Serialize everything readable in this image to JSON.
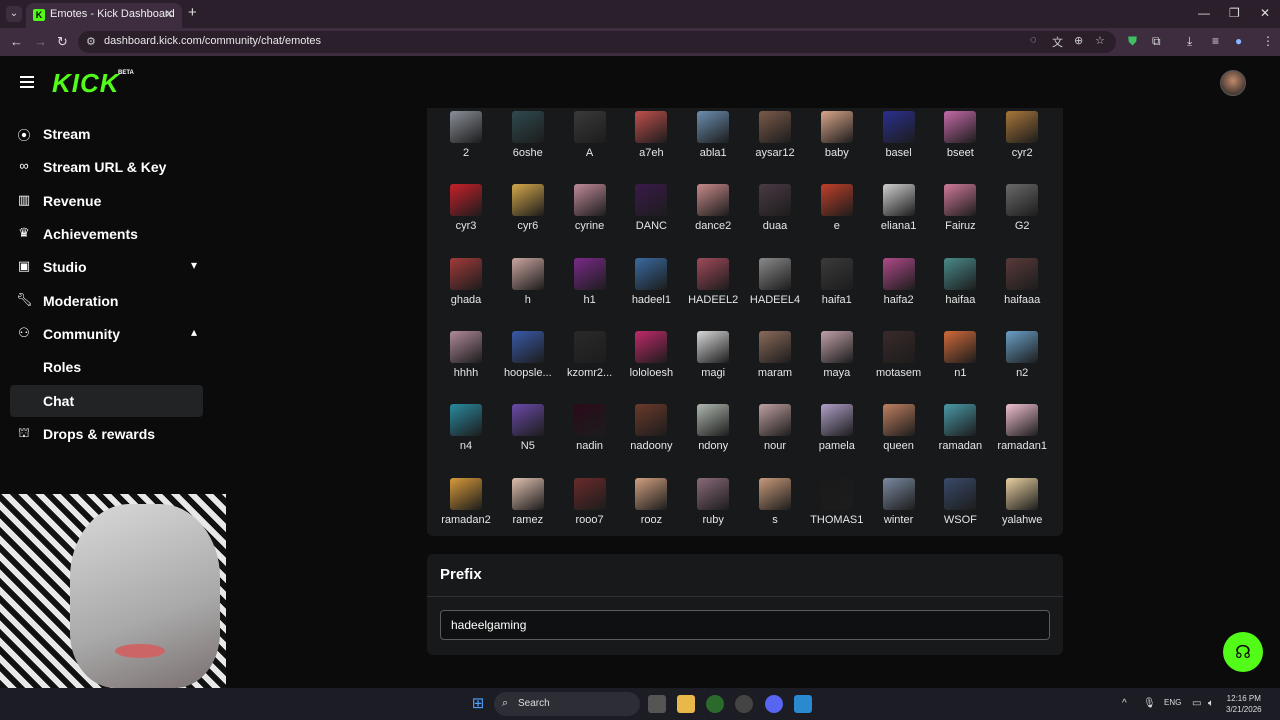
{
  "browser": {
    "tab_title": "Emotes - Kick Dashboard",
    "tab_favicon": "K",
    "url": "dashboard.kick.com/community/chat/emotes"
  },
  "header": {
    "logo": "KICK",
    "beta": "BETA"
  },
  "sidebar": {
    "items": [
      {
        "label": "Stream",
        "icon": "broadcast-icon"
      },
      {
        "label": "Stream URL & Key",
        "icon": "link-icon"
      },
      {
        "label": "Revenue",
        "icon": "chart-icon"
      },
      {
        "label": "Achievements",
        "icon": "trophy-icon"
      },
      {
        "label": "Studio",
        "icon": "studio-icon"
      },
      {
        "label": "Moderation",
        "icon": "wrench-icon"
      },
      {
        "label": "Community",
        "icon": "people-icon"
      },
      {
        "label": "Roles"
      },
      {
        "label": "Chat"
      },
      {
        "label": "Drops & rewards",
        "icon": "gift-icon"
      }
    ]
  },
  "emotes": [
    "2",
    "6oshe",
    "A",
    "a7eh",
    "abla1",
    "aysar12",
    "baby",
    "basel",
    "bseet",
    "cyr2",
    "cyr3",
    "cyr6",
    "cyrine",
    "DANC",
    "dance2",
    "duaa",
    "e",
    "eliana1",
    "Fairuz",
    "G2",
    "ghada",
    "h",
    "h1",
    "hadeel1",
    "HADEEL2",
    "HADEEL4",
    "haifa1",
    "haifa2",
    "haifaa",
    "haifaaa",
    "hhhh",
    "hoopsle...",
    "kzomr2...",
    "lololoesh",
    "magi",
    "maram",
    "maya",
    "motasem",
    "n1",
    "n2",
    "n4",
    "N5",
    "nadin",
    "nadoony",
    "ndony",
    "nour",
    "pamela",
    "queen",
    "ramadan",
    "ramadan1",
    "ramadan2",
    "ramez",
    "rooo7",
    "rooz",
    "ruby",
    "s",
    "THOMAS1",
    "winter",
    "WSOF",
    "yalahwe"
  ],
  "emote_colors": [
    "#8a8f98",
    "#2f4a4f",
    "#3a3a3a",
    "#c0504d",
    "#6b8fb0",
    "#7a5a4a",
    "#d9a58a",
    "#2a2f8f",
    "#c46aa8",
    "#a8763a",
    "#c8202a",
    "#d4a94a",
    "#c08a9a",
    "#3a1a4a",
    "#c88a8a",
    "#4a3a44",
    "#c0402a",
    "#cfcfcf",
    "#d07a9a",
    "#6a6a6a",
    "#a23a3a",
    "#caa6a0",
    "#7a2a8a",
    "#3a6aa0",
    "#a04a5a",
    "#8a8a8a",
    "#3a3a3a",
    "#b04a8a",
    "#4a8a8a",
    "#5a3a3a",
    "#b08a9a",
    "#3a5aa8",
    "#2a2a2a",
    "#c02a6a",
    "#d8d8d8",
    "#8a6a5a",
    "#c0a0a8",
    "#3a2a2a",
    "#d06a3a",
    "#6aa0c8",
    "#2a8aa0",
    "#6a4aa8",
    "#2a0a1a",
    "#6a3a2a",
    "#b0b8b0",
    "#c0a0a0",
    "#b0a0c8",
    "#c08060",
    "#4a9aa8",
    "#f0c0d0",
    "#d89a3a",
    "#e0c0b0",
    "#6a2a2a",
    "#d0a080",
    "#8a6a7a",
    "#c89a7a",
    "#1a1a1a",
    "#7a8aa0",
    "#3a4a6a",
    "#e8d0a0"
  ],
  "prefix": {
    "title": "Prefix",
    "value": "hadeelgaming"
  },
  "taskbar": {
    "search_label": "Search",
    "lang": "ENG",
    "time": "12:16 PM",
    "date": "3/21/2026"
  }
}
